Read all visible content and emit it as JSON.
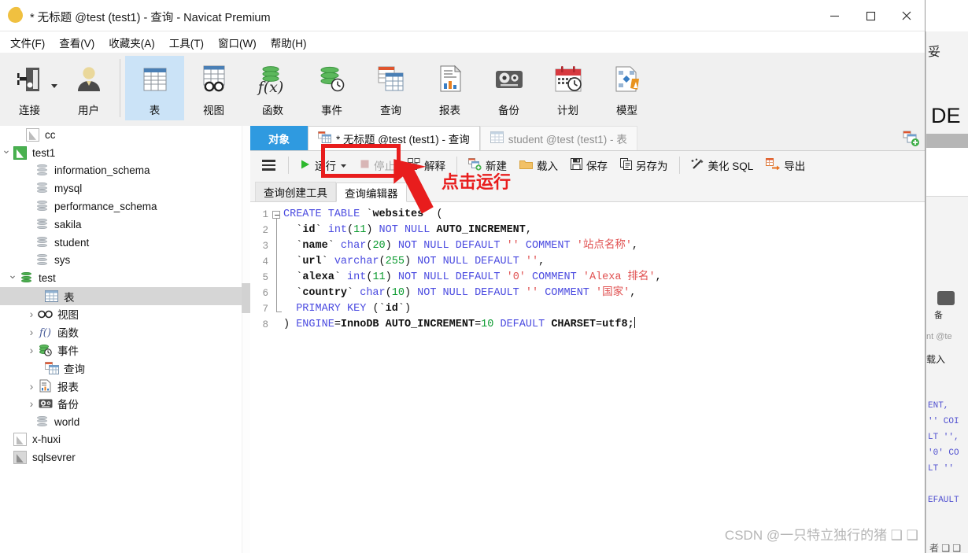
{
  "window": {
    "title": "* 无标题 @test (test1) - 查询 - Navicat Premium",
    "logo_icon": "navicat-logo-icon",
    "minimize_icon": "minimize-icon",
    "maximize_icon": "maximize-icon",
    "close_icon": "close-icon"
  },
  "menubar": {
    "items": [
      {
        "label": "文件(F)"
      },
      {
        "label": "查看(V)"
      },
      {
        "label": "收藏夹(A)"
      },
      {
        "label": "工具(T)"
      },
      {
        "label": "窗口(W)"
      },
      {
        "label": "帮助(H)"
      }
    ]
  },
  "toolbar": {
    "items": [
      {
        "label": "连接",
        "icon": "connection-icon",
        "active": false,
        "has_caret": true
      },
      {
        "label": "用户",
        "icon": "user-icon",
        "active": false,
        "has_caret": false
      },
      {
        "label": "表",
        "icon": "table-icon",
        "active": true,
        "has_caret": false
      },
      {
        "label": "视图",
        "icon": "view-icon",
        "active": false,
        "has_caret": false
      },
      {
        "label": "函数",
        "icon": "function-icon",
        "active": false,
        "has_caret": false
      },
      {
        "label": "事件",
        "icon": "event-icon",
        "active": false,
        "has_caret": false
      },
      {
        "label": "查询",
        "icon": "query-icon",
        "active": false,
        "has_caret": false
      },
      {
        "label": "报表",
        "icon": "report-icon",
        "active": false,
        "has_caret": false
      },
      {
        "label": "备份",
        "icon": "backup-icon",
        "active": false,
        "has_caret": false
      },
      {
        "label": "计划",
        "icon": "schedule-icon",
        "active": false,
        "has_caret": false
      },
      {
        "label": "模型",
        "icon": "model-icon",
        "active": false,
        "has_caret": false
      }
    ]
  },
  "sidebar": {
    "nodes": [
      {
        "label": "cc",
        "indent": 0,
        "chevron": "",
        "icon": "connection-grey-icon"
      },
      {
        "label": "test1",
        "indent": 0,
        "chevron": "down",
        "icon": "connection-green-icon"
      },
      {
        "label": "information_schema",
        "indent": 1,
        "chevron": "",
        "icon": "database-grey-icon"
      },
      {
        "label": "mysql",
        "indent": 1,
        "chevron": "",
        "icon": "database-grey-icon"
      },
      {
        "label": "performance_schema",
        "indent": 1,
        "chevron": "",
        "icon": "database-grey-icon"
      },
      {
        "label": "sakila",
        "indent": 1,
        "chevron": "",
        "icon": "database-grey-icon"
      },
      {
        "label": "student",
        "indent": 1,
        "chevron": "",
        "icon": "database-grey-icon"
      },
      {
        "label": "sys",
        "indent": 1,
        "chevron": "",
        "icon": "database-grey-icon"
      },
      {
        "label": "test",
        "indent": 1,
        "chevron": "down",
        "icon": "database-green-icon"
      },
      {
        "label": "表",
        "indent": 2,
        "chevron": "",
        "icon": "table-icon",
        "selected": true
      },
      {
        "label": "视图",
        "indent": 2,
        "chevron": "right",
        "icon": "view-icon"
      },
      {
        "label": "函数",
        "indent": 2,
        "chevron": "right",
        "icon": "function-icon"
      },
      {
        "label": "事件",
        "indent": 2,
        "chevron": "right",
        "icon": "event-icon"
      },
      {
        "label": "查询",
        "indent": 2,
        "chevron": "",
        "icon": "query-icon"
      },
      {
        "label": "报表",
        "indent": 2,
        "chevron": "right",
        "icon": "report-icon"
      },
      {
        "label": "备份",
        "indent": 2,
        "chevron": "right",
        "icon": "backup-icon"
      },
      {
        "label": "world",
        "indent": 1,
        "chevron": "",
        "icon": "database-grey-icon"
      },
      {
        "label": "x-huxi",
        "indent": 0,
        "chevron": "",
        "icon": "connection-grey-icon"
      },
      {
        "label": "sqlsevrer",
        "indent": 0,
        "chevron": "",
        "icon": "connection-mssql-icon"
      }
    ]
  },
  "tabs": {
    "object_tab": "对象",
    "items": [
      {
        "label": "* 无标题 @test (test1) - 查询",
        "icon": "query-icon",
        "state": "active"
      },
      {
        "label": "student @test (test1) - 表",
        "icon": "table-icon",
        "state": "inactive"
      }
    ],
    "add_tab_icon": "new-tab-icon"
  },
  "editor_toolbar": {
    "menu_icon": "hamburger-menu-icon",
    "buttons": [
      {
        "label": "运行",
        "icon": "play-icon",
        "disabled": false,
        "has_caret": true
      },
      {
        "label": "停止",
        "icon": "stop-icon",
        "disabled": true,
        "has_caret": false
      },
      {
        "label": "解释",
        "icon": "explain-icon",
        "disabled": false,
        "has_caret": false
      },
      {
        "label": "新建",
        "icon": "new-icon",
        "disabled": false,
        "has_caret": false
      },
      {
        "label": "载入",
        "icon": "folder-icon",
        "disabled": false,
        "has_caret": false
      },
      {
        "label": "保存",
        "icon": "save-icon",
        "disabled": false,
        "has_caret": false
      },
      {
        "label": "另存为",
        "icon": "save-as-icon",
        "disabled": false,
        "has_caret": false
      },
      {
        "label": "美化 SQL",
        "icon": "beautify-icon",
        "disabled": false,
        "has_caret": false
      },
      {
        "label": "导出",
        "icon": "export-icon",
        "disabled": false,
        "has_caret": false
      }
    ]
  },
  "sub_tabs": {
    "items": [
      {
        "label": "查询创建工具",
        "state": "inactive"
      },
      {
        "label": "查询编辑器",
        "state": "active"
      }
    ]
  },
  "code_editor": {
    "line_numbers": [
      "1",
      "2",
      "3",
      "4",
      "5",
      "6",
      "7",
      "8"
    ],
    "lines": [
      "CREATE TABLE `websites` (",
      "  `id` int(11) NOT NULL AUTO_INCREMENT,",
      "  `name` char(20) NOT NULL DEFAULT '' COMMENT '站点名称',",
      "  `url` varchar(255) NOT NULL DEFAULT '',",
      "  `alexa` int(11) NOT NULL DEFAULT '0' COMMENT 'Alexa 排名',",
      "  `country` char(10) NOT NULL DEFAULT '' COMMENT '国家',",
      "  PRIMARY KEY (`id`)",
      ") ENGINE=InnoDB AUTO_INCREMENT=10 DEFAULT CHARSET=utf8;"
    ]
  },
  "annotation": {
    "text": "点击运行",
    "color": "#e81d1d",
    "arrow_icon": "red-arrow-icon",
    "box_icon": "red-highlight-box"
  },
  "watermark": {
    "text": "CSDN @一只特立独行的猪 ❑ ❑"
  },
  "background_window": {
    "title_fragment": "妥",
    "big_text": "DE",
    "label_backup": "备",
    "label_tab": "nt @te",
    "label_load": "载入",
    "code_fragment": "ENT,\n'' COI\nLT '',\n'0' CO\nLT ''\n\nEFAULT",
    "bottom_text": "者 ❑ ❑"
  }
}
